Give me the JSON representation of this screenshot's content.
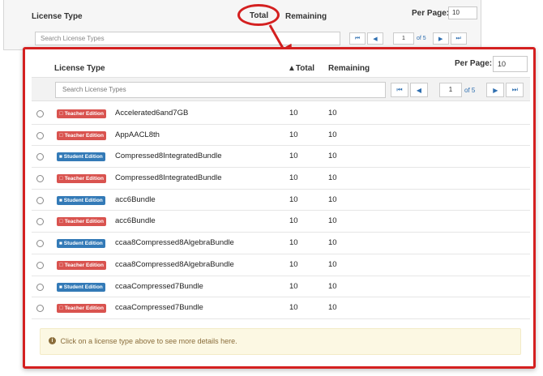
{
  "background_panel": {
    "col_license_type": "License Type",
    "col_total": "Total",
    "col_remaining": "Remaining",
    "per_page_label": "Per Page:",
    "per_page_value": "10",
    "search_placeholder": "Search License Types",
    "pager": {
      "page": "1",
      "of_label": "of 5"
    }
  },
  "main": {
    "col_license_type": "License Type",
    "col_total": "▲Total",
    "col_remaining": "Remaining",
    "per_page_label": "Per Page:",
    "per_page_value": "10",
    "search_placeholder": "Search License Types",
    "pager": {
      "first_icon": "⏮",
      "prev_icon": "◀",
      "page": "1",
      "of_label": "of 5",
      "next_icon": "▶",
      "last_icon": "⏭"
    },
    "rows": [
      {
        "badge": "Teacher Edition",
        "badge_icon": "apple-icon",
        "kind": "teacher",
        "name": "Accelerated6and7GB",
        "total": "10",
        "remaining": "10"
      },
      {
        "badge": "Teacher Edition",
        "badge_icon": "apple-icon",
        "kind": "teacher",
        "name": "AppAACL8th",
        "total": "10",
        "remaining": "10"
      },
      {
        "badge": "Student Edition",
        "badge_icon": "person-icon",
        "kind": "student",
        "name": "Compressed8IntegratedBundle",
        "total": "10",
        "remaining": "10"
      },
      {
        "badge": "Teacher Edition",
        "badge_icon": "apple-icon",
        "kind": "teacher",
        "name": "Compressed8IntegratedBundle",
        "total": "10",
        "remaining": "10"
      },
      {
        "badge": "Student Edition",
        "badge_icon": "person-icon",
        "kind": "student",
        "name": "acc6Bundle",
        "total": "10",
        "remaining": "10"
      },
      {
        "badge": "Teacher Edition",
        "badge_icon": "apple-icon",
        "kind": "teacher",
        "name": "acc6Bundle",
        "total": "10",
        "remaining": "10"
      },
      {
        "badge": "Student Edition",
        "badge_icon": "person-icon",
        "kind": "student",
        "name": "ccaa8Compressed8AlgebraBundle",
        "total": "10",
        "remaining": "10"
      },
      {
        "badge": "Teacher Edition",
        "badge_icon": "apple-icon",
        "kind": "teacher",
        "name": "ccaa8Compressed8AlgebraBundle",
        "total": "10",
        "remaining": "10"
      },
      {
        "badge": "Student Edition",
        "badge_icon": "person-icon",
        "kind": "student",
        "name": "ccaaCompressed7Bundle",
        "total": "10",
        "remaining": "10"
      },
      {
        "badge": "Teacher Edition",
        "badge_icon": "apple-icon",
        "kind": "teacher",
        "name": "ccaaCompressed7Bundle",
        "total": "10",
        "remaining": "10"
      }
    ],
    "info_message": "Click on a license type above to see more details here."
  },
  "colors": {
    "highlight": "#d42020",
    "teacher_badge": "#d9534f",
    "student_badge": "#337ab7",
    "info_bg": "#fcf8e3"
  }
}
